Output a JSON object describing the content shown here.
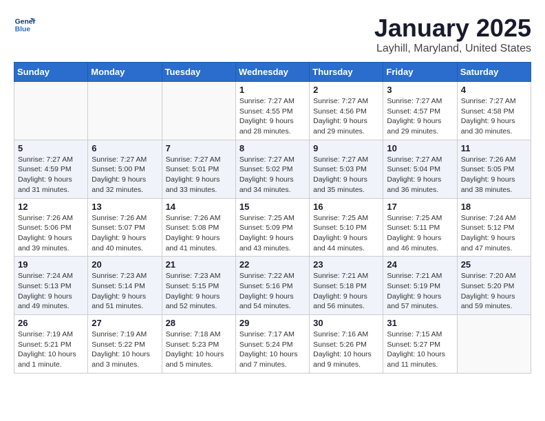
{
  "logo": {
    "line1": "General",
    "line2": "Blue"
  },
  "title": "January 2025",
  "location": "Layhill, Maryland, United States",
  "weekdays": [
    "Sunday",
    "Monday",
    "Tuesday",
    "Wednesday",
    "Thursday",
    "Friday",
    "Saturday"
  ],
  "weeks": [
    [
      {
        "day": "",
        "info": ""
      },
      {
        "day": "",
        "info": ""
      },
      {
        "day": "",
        "info": ""
      },
      {
        "day": "1",
        "info": "Sunrise: 7:27 AM\nSunset: 4:55 PM\nDaylight: 9 hours\nand 28 minutes."
      },
      {
        "day": "2",
        "info": "Sunrise: 7:27 AM\nSunset: 4:56 PM\nDaylight: 9 hours\nand 29 minutes."
      },
      {
        "day": "3",
        "info": "Sunrise: 7:27 AM\nSunset: 4:57 PM\nDaylight: 9 hours\nand 29 minutes."
      },
      {
        "day": "4",
        "info": "Sunrise: 7:27 AM\nSunset: 4:58 PM\nDaylight: 9 hours\nand 30 minutes."
      }
    ],
    [
      {
        "day": "5",
        "info": "Sunrise: 7:27 AM\nSunset: 4:59 PM\nDaylight: 9 hours\nand 31 minutes."
      },
      {
        "day": "6",
        "info": "Sunrise: 7:27 AM\nSunset: 5:00 PM\nDaylight: 9 hours\nand 32 minutes."
      },
      {
        "day": "7",
        "info": "Sunrise: 7:27 AM\nSunset: 5:01 PM\nDaylight: 9 hours\nand 33 minutes."
      },
      {
        "day": "8",
        "info": "Sunrise: 7:27 AM\nSunset: 5:02 PM\nDaylight: 9 hours\nand 34 minutes."
      },
      {
        "day": "9",
        "info": "Sunrise: 7:27 AM\nSunset: 5:03 PM\nDaylight: 9 hours\nand 35 minutes."
      },
      {
        "day": "10",
        "info": "Sunrise: 7:27 AM\nSunset: 5:04 PM\nDaylight: 9 hours\nand 36 minutes."
      },
      {
        "day": "11",
        "info": "Sunrise: 7:26 AM\nSunset: 5:05 PM\nDaylight: 9 hours\nand 38 minutes."
      }
    ],
    [
      {
        "day": "12",
        "info": "Sunrise: 7:26 AM\nSunset: 5:06 PM\nDaylight: 9 hours\nand 39 minutes."
      },
      {
        "day": "13",
        "info": "Sunrise: 7:26 AM\nSunset: 5:07 PM\nDaylight: 9 hours\nand 40 minutes."
      },
      {
        "day": "14",
        "info": "Sunrise: 7:26 AM\nSunset: 5:08 PM\nDaylight: 9 hours\nand 41 minutes."
      },
      {
        "day": "15",
        "info": "Sunrise: 7:25 AM\nSunset: 5:09 PM\nDaylight: 9 hours\nand 43 minutes."
      },
      {
        "day": "16",
        "info": "Sunrise: 7:25 AM\nSunset: 5:10 PM\nDaylight: 9 hours\nand 44 minutes."
      },
      {
        "day": "17",
        "info": "Sunrise: 7:25 AM\nSunset: 5:11 PM\nDaylight: 9 hours\nand 46 minutes."
      },
      {
        "day": "18",
        "info": "Sunrise: 7:24 AM\nSunset: 5:12 PM\nDaylight: 9 hours\nand 47 minutes."
      }
    ],
    [
      {
        "day": "19",
        "info": "Sunrise: 7:24 AM\nSunset: 5:13 PM\nDaylight: 9 hours\nand 49 minutes."
      },
      {
        "day": "20",
        "info": "Sunrise: 7:23 AM\nSunset: 5:14 PM\nDaylight: 9 hours\nand 51 minutes."
      },
      {
        "day": "21",
        "info": "Sunrise: 7:23 AM\nSunset: 5:15 PM\nDaylight: 9 hours\nand 52 minutes."
      },
      {
        "day": "22",
        "info": "Sunrise: 7:22 AM\nSunset: 5:16 PM\nDaylight: 9 hours\nand 54 minutes."
      },
      {
        "day": "23",
        "info": "Sunrise: 7:21 AM\nSunset: 5:18 PM\nDaylight: 9 hours\nand 56 minutes."
      },
      {
        "day": "24",
        "info": "Sunrise: 7:21 AM\nSunset: 5:19 PM\nDaylight: 9 hours\nand 57 minutes."
      },
      {
        "day": "25",
        "info": "Sunrise: 7:20 AM\nSunset: 5:20 PM\nDaylight: 9 hours\nand 59 minutes."
      }
    ],
    [
      {
        "day": "26",
        "info": "Sunrise: 7:19 AM\nSunset: 5:21 PM\nDaylight: 10 hours\nand 1 minute."
      },
      {
        "day": "27",
        "info": "Sunrise: 7:19 AM\nSunset: 5:22 PM\nDaylight: 10 hours\nand 3 minutes."
      },
      {
        "day": "28",
        "info": "Sunrise: 7:18 AM\nSunset: 5:23 PM\nDaylight: 10 hours\nand 5 minutes."
      },
      {
        "day": "29",
        "info": "Sunrise: 7:17 AM\nSunset: 5:24 PM\nDaylight: 10 hours\nand 7 minutes."
      },
      {
        "day": "30",
        "info": "Sunrise: 7:16 AM\nSunset: 5:26 PM\nDaylight: 10 hours\nand 9 minutes."
      },
      {
        "day": "31",
        "info": "Sunrise: 7:15 AM\nSunset: 5:27 PM\nDaylight: 10 hours\nand 11 minutes."
      },
      {
        "day": "",
        "info": ""
      }
    ]
  ]
}
